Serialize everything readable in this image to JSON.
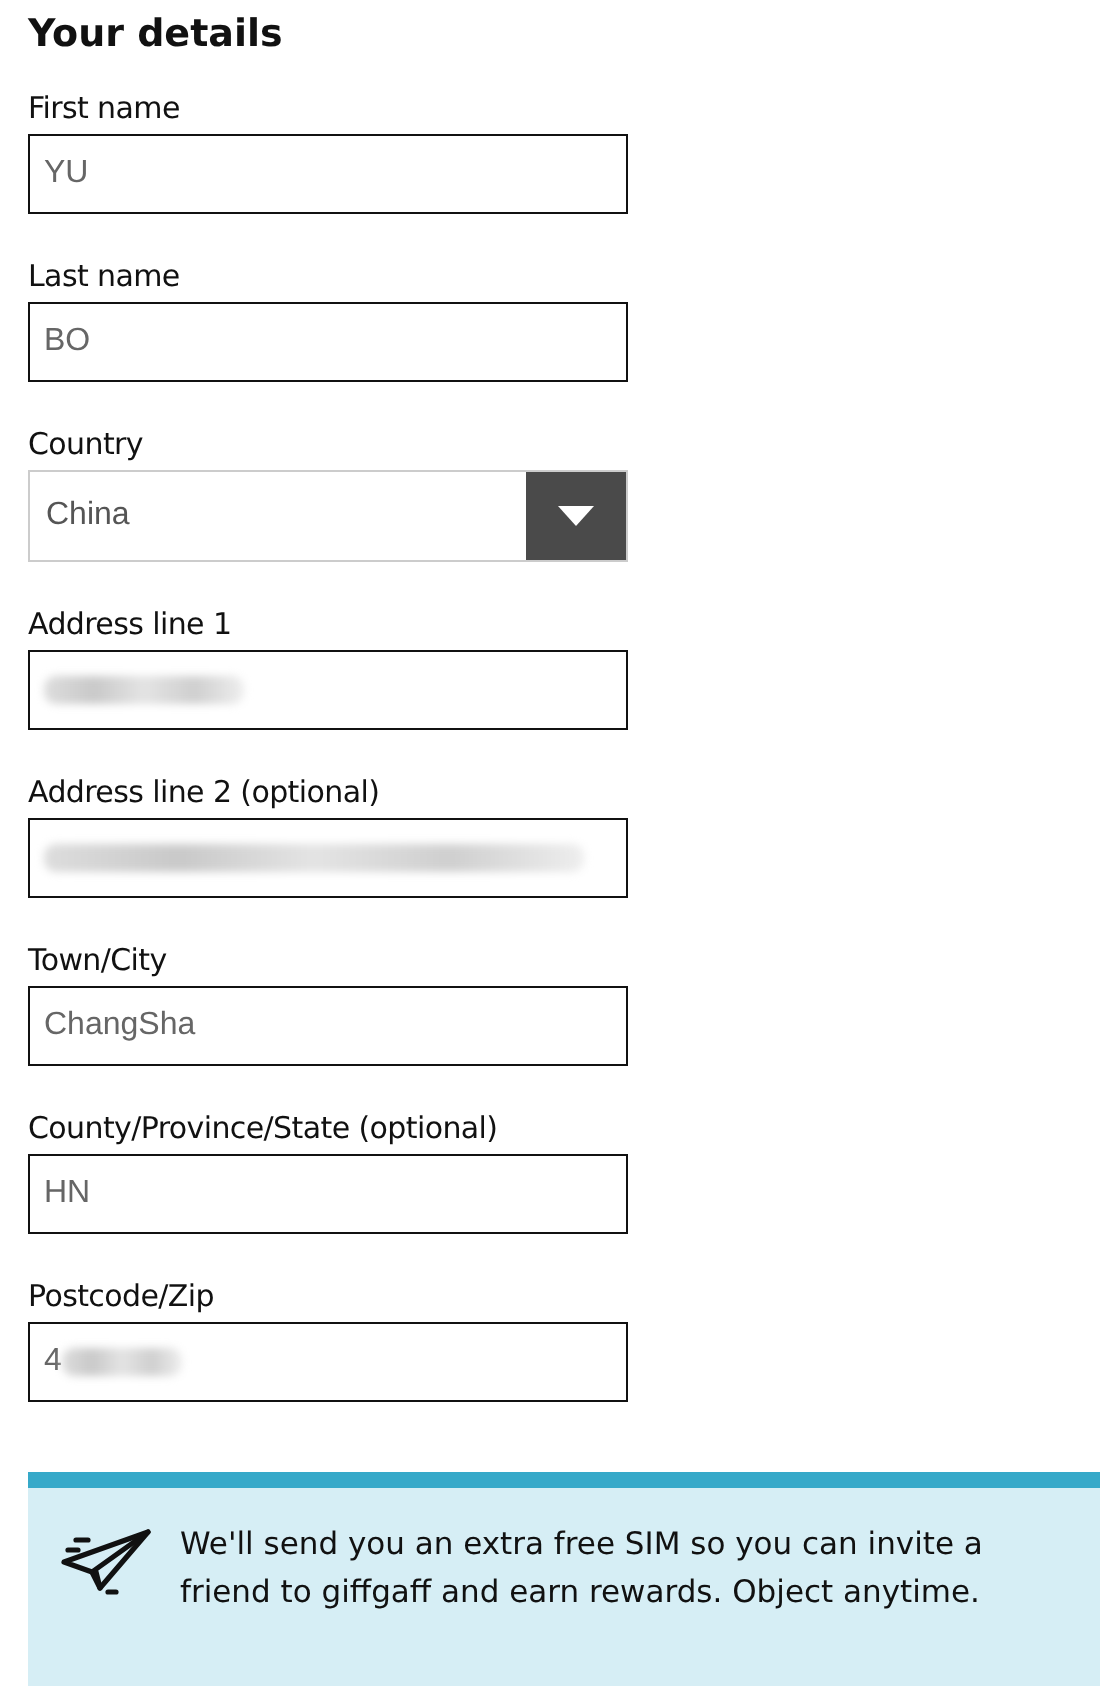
{
  "heading": "Your details",
  "fields": [
    {
      "kind": "text",
      "label": "First name",
      "value": "YU",
      "redacted": false
    },
    {
      "kind": "text",
      "label": "Last name",
      "value": "BO",
      "redacted": false
    },
    {
      "kind": "select",
      "label": "Country",
      "value": "China"
    },
    {
      "kind": "text",
      "label": "Address line 1",
      "redacted": true
    },
    {
      "kind": "text",
      "label": "Address line 2 (optional)",
      "redacted": true
    },
    {
      "kind": "text",
      "label": "Town/City",
      "value": "ChangSha",
      "redacted": false
    },
    {
      "kind": "text",
      "label": "County/Province/State (optional)",
      "value": "HN",
      "redacted": false
    },
    {
      "kind": "text",
      "label": "Postcode/Zip",
      "value": "4",
      "redacted": true
    }
  ],
  "notice": {
    "text": "We'll send you an extra free SIM so you can invite a friend to giffgaff and earn rewards. Object anytime."
  }
}
